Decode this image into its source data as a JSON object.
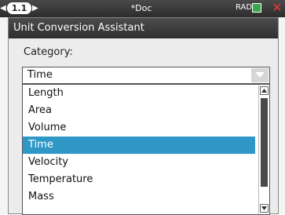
{
  "status_bar": {
    "tab_label": "1.1",
    "document_title": "*Doc",
    "angle_mode": "RAD"
  },
  "dialog": {
    "title": "Unit Conversion Assistant",
    "category_label": "Category:",
    "selected_value": "Time",
    "options": [
      "Length",
      "Area",
      "Volume",
      "Time",
      "Velocity",
      "Temperature",
      "Mass"
    ],
    "highlighted_option": "Time"
  },
  "colors": {
    "selection": "#2f97c6",
    "title_bar": "#3a3a3a",
    "close": "#e53935"
  }
}
